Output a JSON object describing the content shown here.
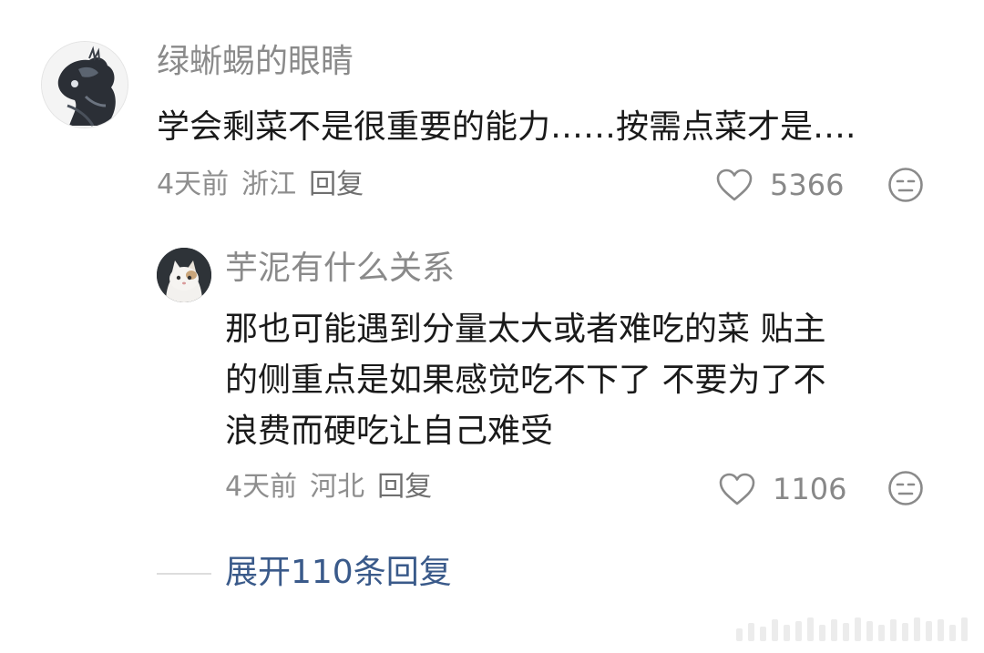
{
  "comment": {
    "username": "绿蜥蜴的眼睛",
    "text": "学会剩菜不是很重要的能力……按需点菜才是….",
    "time": "4天前",
    "location": "浙江",
    "reply_label": "回复",
    "like_count": "5366",
    "like_icon": "heart-outline-icon",
    "reaction_icon": "meh-face-icon"
  },
  "reply": {
    "username": "芋泥有什么关系",
    "text_lines": [
      "那也可能遇到分量太大或者难吃的菜 贴主",
      "的侧重点是如果感觉吃不下了 不要为了不",
      "浪费而硬吃让自己难受"
    ],
    "time": "4天前",
    "location": "河北",
    "reply_label": "回复",
    "like_count": "1106",
    "like_icon": "heart-outline-icon",
    "reaction_icon": "meh-face-icon"
  },
  "expand": {
    "label": "展开110条回复"
  },
  "colors": {
    "username": "#8a8a8a",
    "body_text": "#1a1a1a",
    "meta": "#8e8e8e",
    "expand_link": "#3a5a8a"
  }
}
